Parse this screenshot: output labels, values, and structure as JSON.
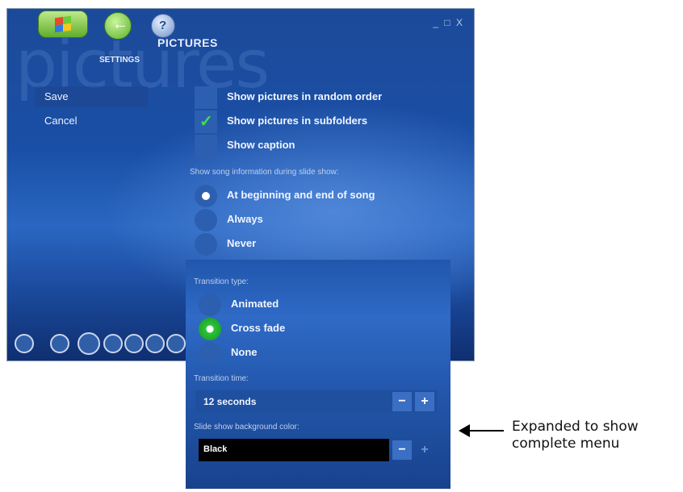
{
  "window": {
    "background_word": "pictures",
    "title": "PICTURES",
    "breadcrumb": "SETTINGS",
    "controls": "_ □ X"
  },
  "sidebar": {
    "save_label": "Save",
    "cancel_label": "Cancel"
  },
  "options": {
    "checkboxes": [
      {
        "label": "Show pictures in random order",
        "checked": false
      },
      {
        "label": "Show pictures in subfolders",
        "checked": true
      },
      {
        "label": "Show caption",
        "checked": false
      }
    ],
    "song_info_heading": "Show song information during slide show:",
    "song_info_radios": [
      {
        "label": "At beginning and end of song",
        "selected": true
      },
      {
        "label": "Always",
        "selected": false
      },
      {
        "label": "Never",
        "selected": false
      }
    ],
    "transition_type_heading": "Transition type:",
    "transition_radios": [
      {
        "label": "Animated",
        "selected": false
      },
      {
        "label": "Cross fade",
        "selected": true
      },
      {
        "label": "None",
        "selected": false
      }
    ],
    "transition_time_heading": "Transition time:",
    "transition_time_value": "12 seconds",
    "background_color_heading": "Slide show background color:",
    "background_color_value": "Black",
    "minus_label": "−",
    "plus_label": "+"
  },
  "annotation": {
    "line1": "Expanded to show",
    "line2": "complete menu"
  },
  "icons": {
    "start": "windows-flag-icon",
    "back": "back-arrow-icon",
    "help": "help-icon",
    "arrow": "left-arrow-icon"
  },
  "colors": {
    "background": "#1a4fa6",
    "accent_green": "#3be04a"
  }
}
